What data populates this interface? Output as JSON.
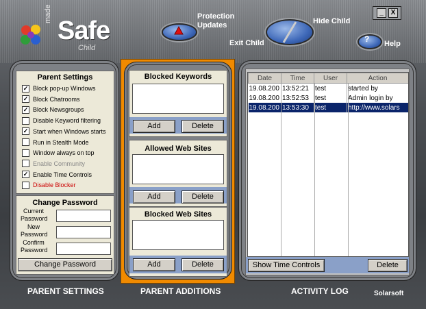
{
  "window_controls": {
    "minimize": "_",
    "close": "X"
  },
  "logo": {
    "made": "made",
    "safe": "Safe",
    "child": "Child"
  },
  "top": {
    "protection_updates": [
      "Protection",
      "Updates"
    ],
    "exit_child": "Exit Child",
    "hide_child": "Hide Child",
    "help": "Help"
  },
  "parent_settings": {
    "title": "Parent Settings",
    "items": [
      {
        "label": "Block pop-up Windows",
        "checked": true,
        "enabled": true
      },
      {
        "label": "Block Chatrooms",
        "checked": true,
        "enabled": true
      },
      {
        "label": "Block Newsgroups",
        "checked": true,
        "enabled": true
      },
      {
        "label": "Disable Keyword filtering",
        "checked": false,
        "enabled": true
      },
      {
        "label": "Start when Windows starts",
        "checked": true,
        "enabled": true
      },
      {
        "label": "Run in Stealth Mode",
        "checked": false,
        "enabled": true
      },
      {
        "label": "Window always on top",
        "checked": false,
        "enabled": true
      },
      {
        "label": "Enable Community",
        "checked": false,
        "enabled": false
      },
      {
        "label": "Enable Time Controls",
        "checked": true,
        "enabled": true
      },
      {
        "label": "Disable Blocker",
        "checked": false,
        "enabled": true,
        "color": "#cc0000"
      }
    ],
    "change_password_title": "Change Password",
    "current": [
      "Current",
      "Password"
    ],
    "new": [
      "New",
      "Password"
    ],
    "confirm": [
      "Confirm",
      "Password"
    ],
    "change_button": "Change Password"
  },
  "additions": {
    "blocked_keywords": "Blocked Keywords",
    "allowed_sites": "Allowed Web Sites",
    "blocked_sites": "Blocked Web Sites",
    "add": "Add",
    "delete": "Delete"
  },
  "activity": {
    "columns": [
      "Date",
      "Time",
      "User",
      "Action"
    ],
    "rows": [
      [
        "19.08.200",
        "13:52:21",
        "test",
        "started by"
      ],
      [
        "19.08.200",
        "13:52:53",
        "test",
        "Admin login by"
      ],
      [
        "19.08.200",
        "13:53:30",
        "test",
        "http://www.solars"
      ]
    ],
    "selected_row": 2,
    "show_time_controls": "Show Time Controls",
    "delete": "Delete"
  },
  "footer": {
    "parent_settings": "PARENT SETTINGS",
    "parent_additions": "PARENT ADDITIONS",
    "activity_log": "ACTIVITY LOG",
    "brand": "Solarsoft"
  },
  "colors": {
    "accent_orange": "#f08a00",
    "selection": "#0a246a",
    "disabled_red": "#cc0000"
  }
}
